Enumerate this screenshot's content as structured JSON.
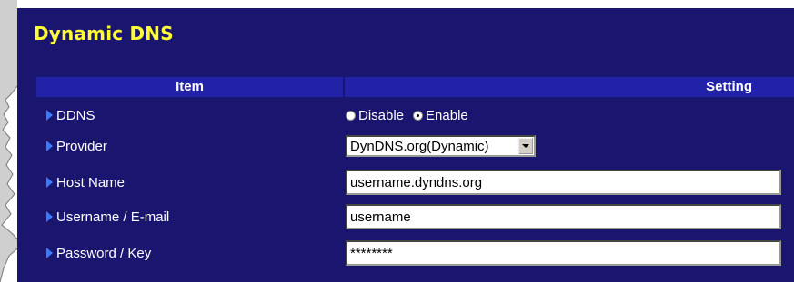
{
  "page": {
    "title": "Dynamic DNS"
  },
  "table": {
    "headers": {
      "item": "Item",
      "setting": "Setting"
    },
    "rows": {
      "ddns": {
        "label": "DDNS",
        "options": [
          {
            "label": "Disable",
            "selected": false
          },
          {
            "label": "Enable",
            "selected": true
          }
        ]
      },
      "provider": {
        "label": "Provider",
        "selected": "DynDNS.org(Dynamic)"
      },
      "host_name": {
        "label": "Host Name",
        "value": "username.dyndns.org"
      },
      "username": {
        "label": "Username / E-mail",
        "value": "username"
      },
      "password": {
        "label": "Password / Key",
        "value": "********"
      }
    }
  },
  "colors": {
    "panel": "#1a1670",
    "header_bar": "#2222a8",
    "title": "#ffff33",
    "arrow": "#3a7bff"
  },
  "icons": {
    "row_marker": "arrow-right-icon"
  }
}
